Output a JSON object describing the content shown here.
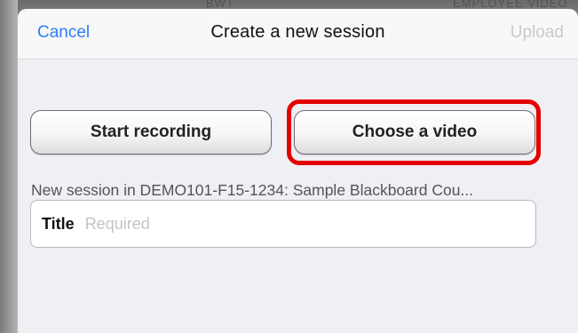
{
  "background": {
    "left_text": "BWT",
    "right_text": "EMPLOYEE VIDEO"
  },
  "navbar": {
    "cancel_label": "Cancel",
    "title": "Create a new session",
    "upload_label": "Upload"
  },
  "buttons": {
    "start_recording": "Start recording",
    "choose_video": "Choose a video"
  },
  "session": {
    "description": "New session in DEMO101-F15-1234: Sample Blackboard Cou...",
    "title_label": "Title",
    "title_placeholder": "Required",
    "title_value": ""
  },
  "colors": {
    "accent": "#2f7df6",
    "disabled": "#c9c9ce",
    "highlight": "#e50000",
    "sheet_background": "#efeff4"
  }
}
